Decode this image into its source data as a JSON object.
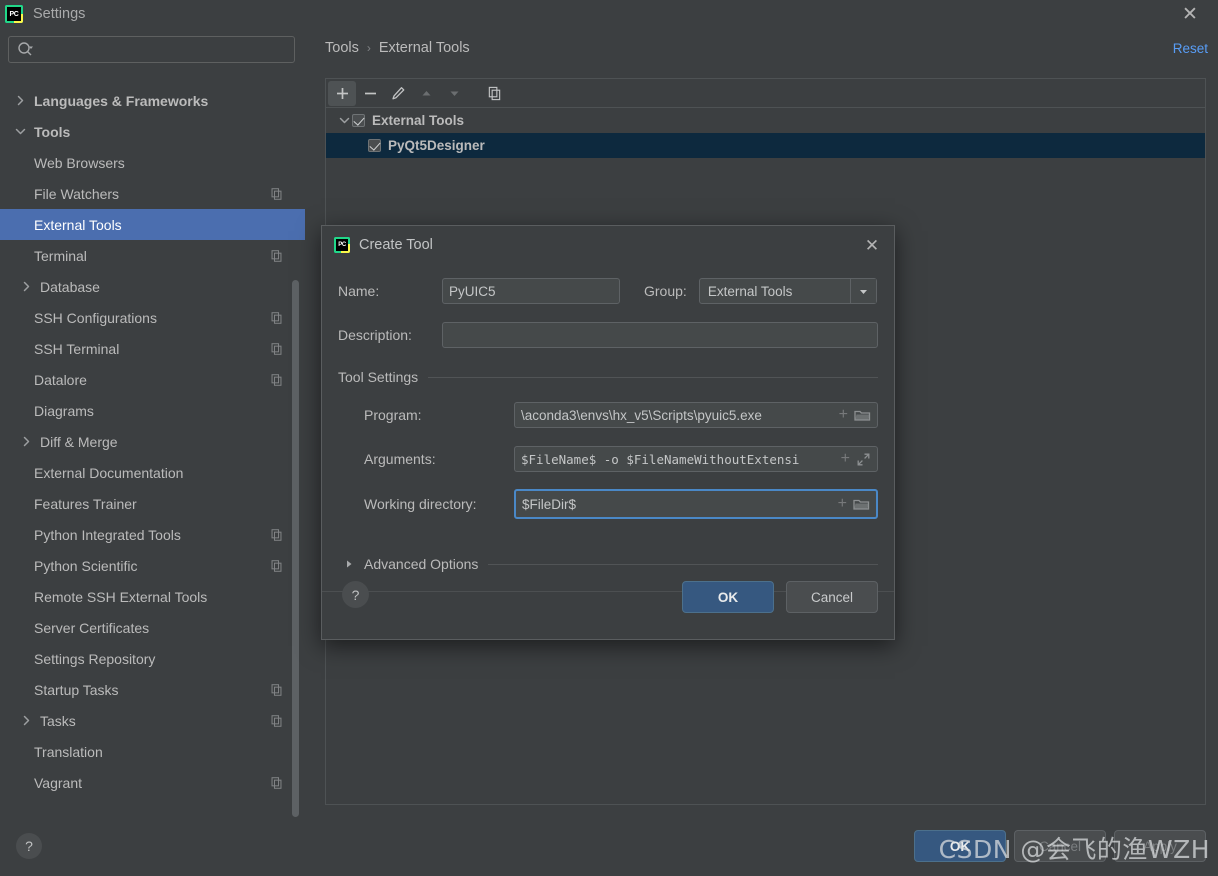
{
  "window": {
    "title": "Settings",
    "logo_text": "PC",
    "close_icon": "close-icon"
  },
  "search": {
    "value": "",
    "placeholder": ""
  },
  "sidebar": {
    "clipped_row_hint": "",
    "items": [
      {
        "label": "Languages & Frameworks",
        "level": 0,
        "arrow": "right",
        "bold": true,
        "copy": false,
        "selected": false
      },
      {
        "label": "Tools",
        "level": 0,
        "arrow": "down",
        "bold": true,
        "copy": false,
        "selected": false
      },
      {
        "label": "Web Browsers",
        "level": 1,
        "arrow": "none",
        "bold": false,
        "copy": false,
        "selected": false
      },
      {
        "label": "File Watchers",
        "level": 1,
        "arrow": "none",
        "bold": false,
        "copy": true,
        "selected": false
      },
      {
        "label": "External Tools",
        "level": 1,
        "arrow": "none",
        "bold": false,
        "copy": false,
        "selected": true
      },
      {
        "label": "Terminal",
        "level": 1,
        "arrow": "none",
        "bold": false,
        "copy": true,
        "selected": false
      },
      {
        "label": "Database",
        "level": 1,
        "arrow": "right",
        "bold": false,
        "copy": false,
        "selected": false
      },
      {
        "label": "SSH Configurations",
        "level": 1,
        "arrow": "none",
        "bold": false,
        "copy": true,
        "selected": false
      },
      {
        "label": "SSH Terminal",
        "level": 1,
        "arrow": "none",
        "bold": false,
        "copy": true,
        "selected": false
      },
      {
        "label": "Datalore",
        "level": 1,
        "arrow": "none",
        "bold": false,
        "copy": true,
        "selected": false
      },
      {
        "label": "Diagrams",
        "level": 1,
        "arrow": "none",
        "bold": false,
        "copy": false,
        "selected": false
      },
      {
        "label": "Diff & Merge",
        "level": 1,
        "arrow": "right",
        "bold": false,
        "copy": false,
        "selected": false
      },
      {
        "label": "External Documentation",
        "level": 1,
        "arrow": "none",
        "bold": false,
        "copy": false,
        "selected": false
      },
      {
        "label": "Features Trainer",
        "level": 1,
        "arrow": "none",
        "bold": false,
        "copy": false,
        "selected": false
      },
      {
        "label": "Python Integrated Tools",
        "level": 1,
        "arrow": "none",
        "bold": false,
        "copy": true,
        "selected": false
      },
      {
        "label": "Python Scientific",
        "level": 1,
        "arrow": "none",
        "bold": false,
        "copy": true,
        "selected": false
      },
      {
        "label": "Remote SSH External Tools",
        "level": 1,
        "arrow": "none",
        "bold": false,
        "copy": false,
        "selected": false
      },
      {
        "label": "Server Certificates",
        "level": 1,
        "arrow": "none",
        "bold": false,
        "copy": false,
        "selected": false
      },
      {
        "label": "Settings Repository",
        "level": 1,
        "arrow": "none",
        "bold": false,
        "copy": false,
        "selected": false
      },
      {
        "label": "Startup Tasks",
        "level": 1,
        "arrow": "none",
        "bold": false,
        "copy": true,
        "selected": false
      },
      {
        "label": "Tasks",
        "level": 1,
        "arrow": "right",
        "bold": false,
        "copy": true,
        "selected": false
      },
      {
        "label": "Translation",
        "level": 1,
        "arrow": "none",
        "bold": false,
        "copy": false,
        "selected": false
      },
      {
        "label": "Vagrant",
        "level": 1,
        "arrow": "none",
        "bold": false,
        "copy": true,
        "selected": false
      }
    ]
  },
  "main": {
    "breadcrumb": {
      "parent": "Tools",
      "separator": "›",
      "current": "External Tools"
    },
    "reset_label": "Reset",
    "toolbar": [
      {
        "name": "add-tool-button",
        "icon": "plus-icon",
        "state": "active"
      },
      {
        "name": "remove-tool-button",
        "icon": "minus-icon",
        "state": "enabled"
      },
      {
        "name": "edit-tool-button",
        "icon": "pencil-icon",
        "state": "enabled"
      },
      {
        "name": "move-up-button",
        "icon": "arrow-up-icon",
        "state": "disabled"
      },
      {
        "name": "move-down-button",
        "icon": "arrow-down-icon",
        "state": "disabled"
      },
      {
        "name": "copy-tool-button",
        "icon": "copy-icon",
        "state": "enabled"
      }
    ],
    "tree": [
      {
        "label": "External Tools",
        "checked": true,
        "expanded": true,
        "level": 0,
        "selected": false
      },
      {
        "label": "PyQt5Designer",
        "checked": true,
        "expanded": null,
        "level": 1,
        "selected": true
      }
    ]
  },
  "dialog": {
    "title": "Create Tool",
    "logo_text": "PC",
    "name_label": "Name:",
    "name_value": "PyUIC5",
    "group_label": "Group:",
    "group_value": "External Tools",
    "description_label": "Description:",
    "description_value": "",
    "tool_settings_label": "Tool Settings",
    "program_label": "Program:",
    "program_value": "\\aconda3\\envs\\hx_v5\\Scripts\\pyuic5.exe",
    "arguments_label": "Arguments:",
    "arguments_value": "$FileName$ -o $FileNameWithoutExtensi",
    "working_dir_label": "Working directory:",
    "working_dir_value": "$FileDir$",
    "advanced_options_label": "Advanced Options",
    "help_label": "?",
    "ok_label": "OK",
    "cancel_label": "Cancel"
  },
  "footer": {
    "help_label": "?",
    "ok_label": "OK",
    "cancel_label": "Cancel",
    "apply_label": "Apply",
    "watermark": "CSDN @会飞的渔WZH"
  },
  "colors": {
    "bg": "#3c3f41",
    "selection_blue": "#4b6eaf",
    "row_selection": "#0d293e",
    "link": "#589df6",
    "primary_button": "#365880",
    "focus_ring": "#4a88c7"
  }
}
